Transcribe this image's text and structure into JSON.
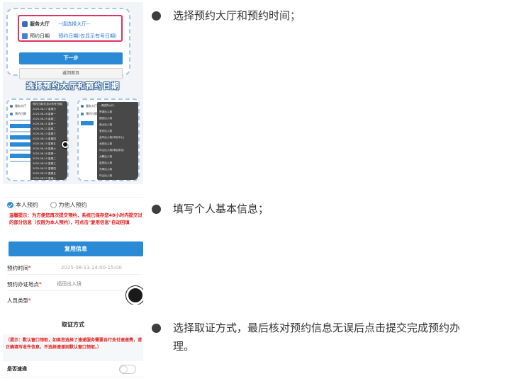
{
  "panel1": {
    "hall_label": "服务大厅",
    "hall_value": "--请选择大厅--",
    "date_label": "预约日期",
    "date_value": "预约日期(仅显示有号日期)",
    "next_button": "下一步",
    "home_button": "返回首页",
    "caption": "选择预约大厅和预约日期",
    "mini_left": {
      "hall": "服务大厅",
      "date": "预约日期",
      "dropdown": [
        "预约日期(仅显示有号日期)",
        "2025-08-17 星期日",
        "2025-08-18 星期一",
        "2025-08-19 星期二",
        "2025-08-11 星期一",
        "2025-08-12 星期二",
        "2025-08-13 星期三",
        "2025-08-14 星期四",
        "2025-08-15 星期五",
        "2025-08-16 星期六",
        "2025-08-18 星期一",
        "2025-08-19 星期二",
        "2025-08-20 星期三",
        "2025-08-21 星期四",
        "2025-08-22 星期五",
        "2025-08-23 星期六"
      ]
    },
    "mini_right": {
      "hall": "服务大厅",
      "date": "预约日期",
      "dropdown": [
        "--请选择大厅--",
        "罗湖出入境",
        "福田出入境",
        "南山出入境",
        "宝安出入境",
        "龙华出入境(市民中心)",
        "龙岗出入境",
        "坪山出入境(湾区综合)",
        "大鹏出入境",
        "盐田出入境",
        "光明出入境",
        "坪山出入境"
      ]
    }
  },
  "panel2": {
    "self_option": "本人预约",
    "other_option": "为他人预约",
    "warning": "温馨提示：为方便您再次提交预约，系统已保存您48小时内提交过的部分信息（仅限为本人预约），可点击\"复用信息\"自动回填",
    "reuse_button": "复用信息",
    "fields": [
      {
        "label": "预约时间",
        "required": "*",
        "value": "2025-08-13 14:00-15:00"
      },
      {
        "label": "预约办证地点",
        "required": "*",
        "value": "福田出入境"
      },
      {
        "label": "人员类型",
        "required": "*",
        "value": ""
      }
    ]
  },
  "panel3": {
    "header": "取证方式",
    "note": "（提示：默认窗口领取，如果您选择了速递服务需要自行支付速递费，请正确填写收件信息，不选择速递则默认窗口领取。）",
    "express_label": "是否速递"
  },
  "steps": [
    {
      "text": "选择预约大厅和预约时间；"
    },
    {
      "text": "填写个人基本信息；"
    },
    {
      "text_line1": "选择取证方式，最后核对预约信息无误后点击提交完成预约办",
      "text_line2": "理。"
    }
  ]
}
